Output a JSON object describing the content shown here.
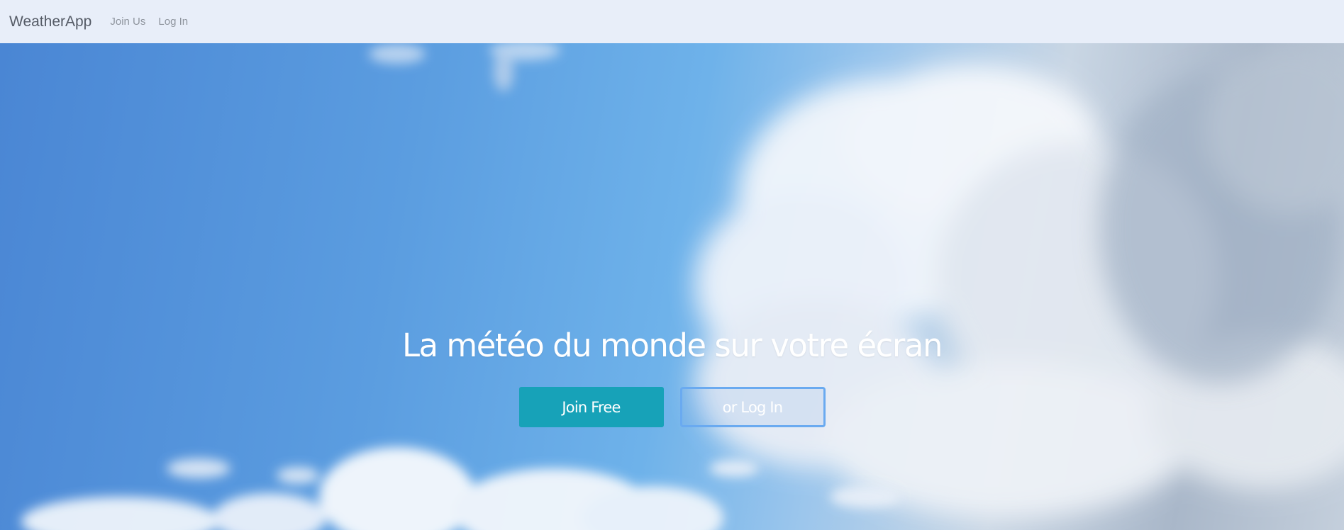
{
  "navbar": {
    "brand": "WeatherApp",
    "links": [
      "Join Us",
      "Log In"
    ]
  },
  "hero": {
    "headline": "La météo du monde sur votre écran",
    "join_button": "Join Free",
    "login_button": "or Log In"
  },
  "colors": {
    "navbar_bg": "#e8eef9",
    "join_button_bg": "#17a2b8",
    "login_button_border": "#6aaaf0",
    "sky_blue": "#5b9de0"
  }
}
